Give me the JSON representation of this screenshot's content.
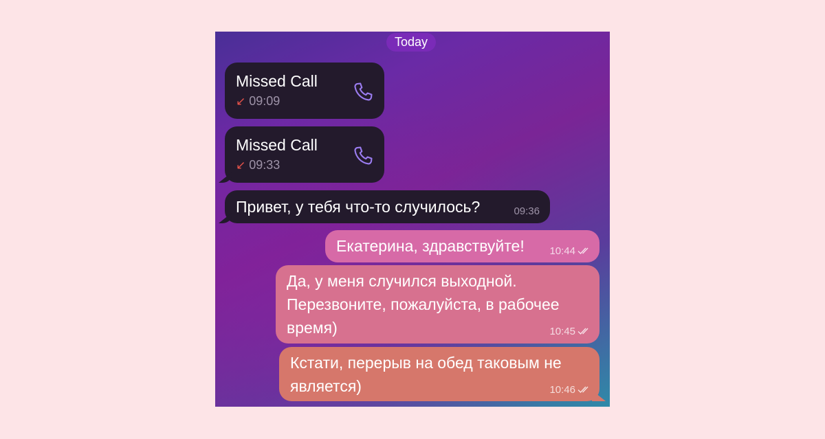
{
  "date_label": "Today",
  "calls": [
    {
      "title": "Missed Call",
      "arrow": "↙",
      "time": "09:09"
    },
    {
      "title": "Missed Call",
      "arrow": "↙",
      "time": "09:33"
    }
  ],
  "incoming": [
    {
      "text": "Привет, у тебя что-то случилось?",
      "time": "09:36"
    }
  ],
  "outgoing": [
    {
      "lines": [
        "Екатерина, здравствуйте!"
      ],
      "time": "10:44"
    },
    {
      "lines": [
        "Да, у меня случился выходной.",
        "Перезвоните, пожалуйста, в рабочее",
        "время)"
      ],
      "time": "10:45"
    },
    {
      "lines": [
        "Кстати, перерыв на обед таковым не",
        "является)"
      ],
      "time": "10:46"
    }
  ],
  "icons": {
    "call": "phone-icon",
    "missed": "arrow-down-left-icon",
    "read": "double-check-icon"
  },
  "colors": {
    "page_bg": "#fde4e7",
    "incoming_bubble": "#231a2c",
    "date_pill": "#7a2bb8",
    "missed_arrow": "#e8534a",
    "phone_icon": "#9b7cf0",
    "outgoing_top": "#d96aa6",
    "outgoing_bottom": "#d9766d"
  }
}
